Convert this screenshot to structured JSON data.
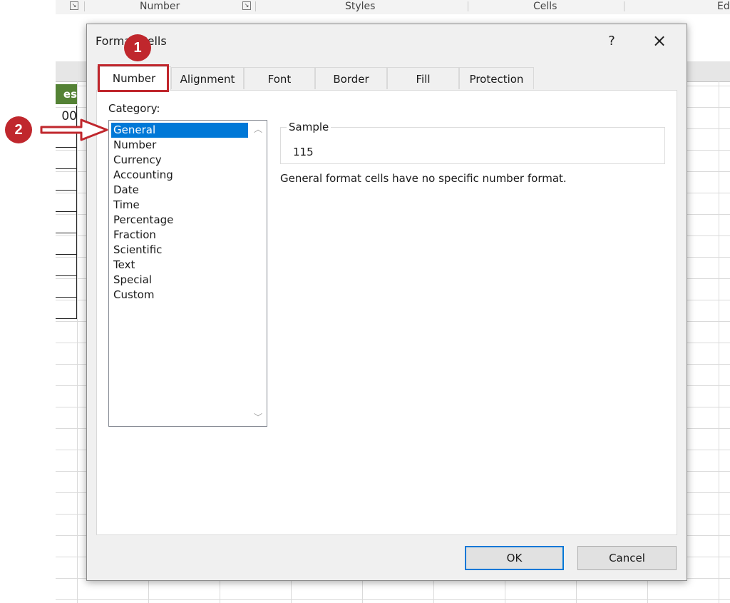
{
  "ribbon": {
    "groups": [
      "Number",
      "Styles",
      "Cells",
      "Ed"
    ]
  },
  "sheet": {
    "header_cell": "es",
    "value_cell": "00"
  },
  "dialog": {
    "title": "Format Cells",
    "help_label": "?",
    "close_label": "×",
    "tabs": [
      {
        "label": "Number",
        "active": true
      },
      {
        "label": "Alignment"
      },
      {
        "label": "Font"
      },
      {
        "label": "Border"
      },
      {
        "label": "Fill"
      },
      {
        "label": "Protection"
      }
    ],
    "category_label": "Category:",
    "categories": [
      "General",
      "Number",
      "Currency",
      "Accounting",
      "Date",
      "Time",
      "Percentage",
      "Fraction",
      "Scientific",
      "Text",
      "Special",
      "Custom"
    ],
    "selected_category": "General",
    "sample_label": "Sample",
    "sample_value": "115",
    "description": "General format cells have no specific number format.",
    "ok_label": "OK",
    "cancel_label": "Cancel"
  },
  "annotations": {
    "badge1": "1",
    "badge2": "2",
    "color": "#c0272d"
  }
}
